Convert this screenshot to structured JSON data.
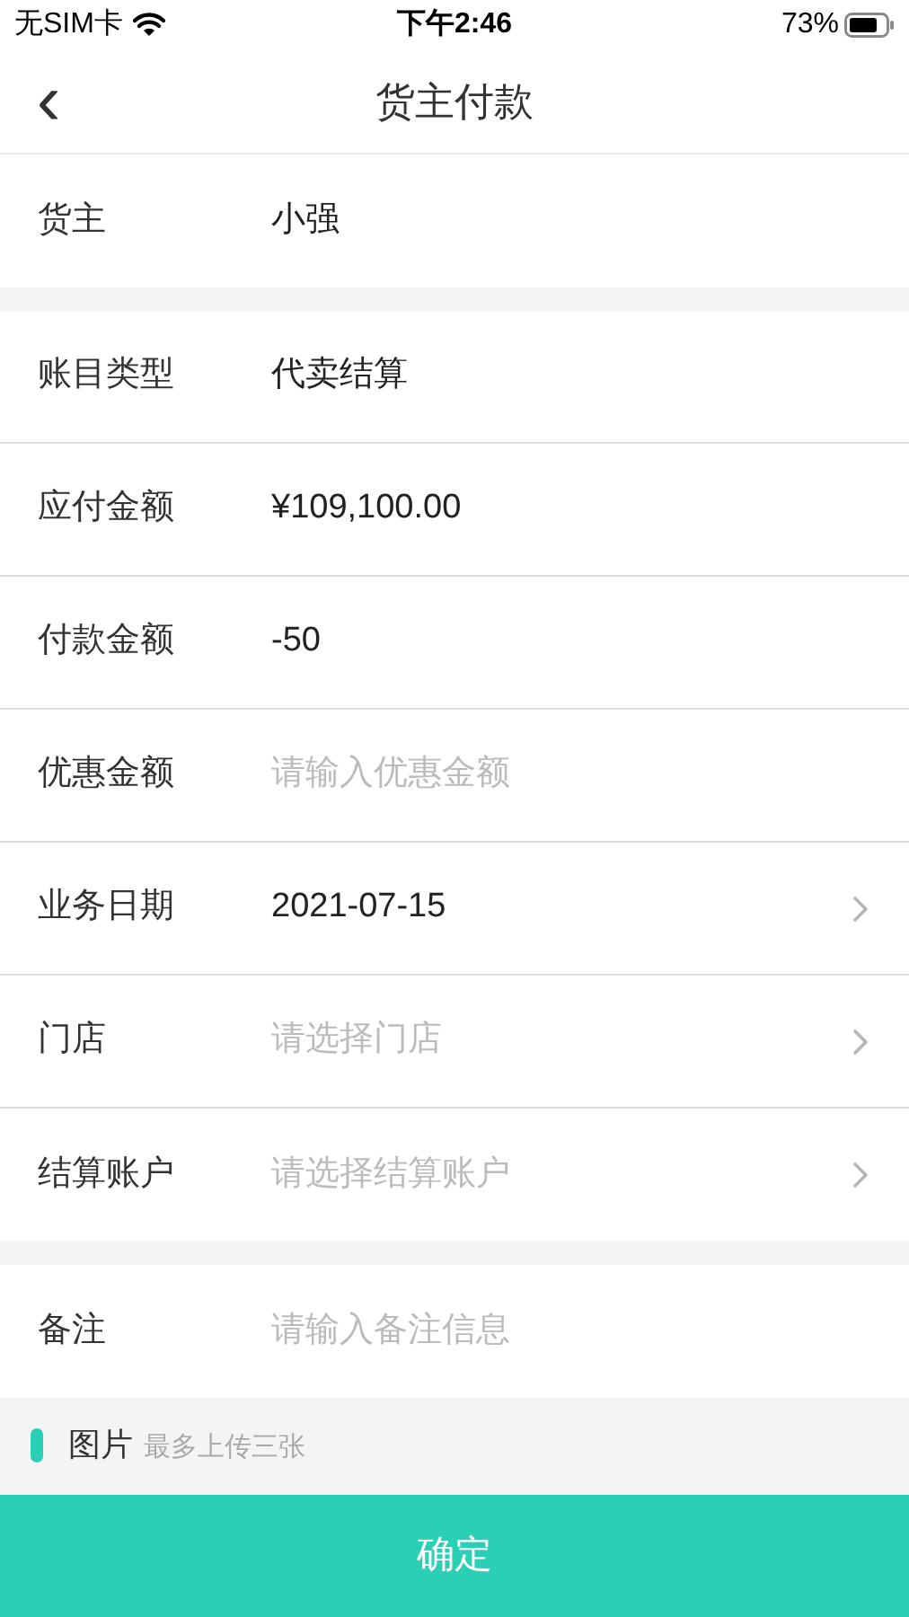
{
  "status_bar": {
    "carrier": "无SIM卡",
    "time": "下午2:46",
    "battery": "73%"
  },
  "nav": {
    "back": "‹",
    "title": "货主付款"
  },
  "groups": [
    {
      "rows": [
        {
          "label": "货主",
          "value": "小强",
          "chevron": false
        }
      ]
    },
    {
      "rows": [
        {
          "label": "账目类型",
          "value": "代卖结算",
          "chevron": false
        },
        {
          "label": "应付金额",
          "value": "¥109,100.00",
          "chevron": false
        },
        {
          "label": "付款金额",
          "value": "-50",
          "chevron": false
        },
        {
          "label": "优惠金额",
          "placeholder": "请输入优惠金额",
          "chevron": false
        },
        {
          "label": "业务日期",
          "value": "2021-07-15",
          "chevron": true
        },
        {
          "label": "门店",
          "placeholder": "请选择门店",
          "chevron": true
        },
        {
          "label": "结算账户",
          "placeholder": "请选择结算账户",
          "chevron": true
        }
      ]
    },
    {
      "rows": [
        {
          "label": "备注",
          "placeholder": "请输入备注信息",
          "chevron": false
        }
      ]
    }
  ],
  "photos": {
    "title": "图片",
    "hint": "最多上传三张"
  },
  "confirm": "确定"
}
